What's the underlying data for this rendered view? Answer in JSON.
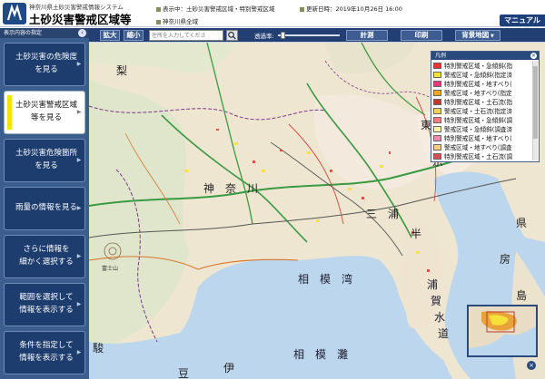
{
  "header": {
    "system_name": "神奈川県土砂災害警戒情報システム",
    "page_title": "土砂災害警戒区域等",
    "display_label": "表示中：土砂災害警戒区域・特別警戒区域",
    "area_label": "神奈川県全域",
    "updated_label": "更新日時：2019年10月26日 16:00",
    "manual_label": "マニュアル"
  },
  "sidebar": {
    "heading": "表示内容の指定",
    "collapse_icon": "chevron-left-icon",
    "items": [
      {
        "label_line1": "土砂災害の危険度",
        "label_line2": "を見る",
        "active": false
      },
      {
        "label_line1": "土砂災害警戒区域",
        "label_line2": "等を見る",
        "active": true
      },
      {
        "label_line1": "土砂災害危険箇所",
        "label_line2": "を見る",
        "active": false
      },
      {
        "label_line1": "雨量の情報を見る",
        "label_line2": "",
        "active": false
      },
      {
        "label_line1": "さらに情報を",
        "label_line2": "細かく選択する",
        "active": false
      },
      {
        "label_line1": "範囲を選択して",
        "label_line2": "情報を表示する",
        "active": false
      },
      {
        "label_line1": "条件を指定して",
        "label_line2": "情報を表示する",
        "active": false
      }
    ]
  },
  "toolbar": {
    "zoom_in": "拡大",
    "zoom_out": "縮小",
    "search_placeholder": "住所を入力してくださ",
    "search_icon": "search-icon",
    "opacity_label": "透過率:",
    "opacity_value": 0.05,
    "measure": "計測",
    "print": "印刷",
    "basemap": "背景地図",
    "basemap_icon": "chevron-down-icon"
  },
  "legend": {
    "heading": "凡例",
    "items": [
      {
        "label": "特別警戒区域・急傾斜(指",
        "color": "#e8372a"
      },
      {
        "label": "警戒区域・急傾斜(指定済",
        "color": "#f5e13a"
      },
      {
        "label": "特別警戒区域・地すべり(",
        "color": "#e23a7a"
      },
      {
        "label": "警戒区域・地すべり(指定",
        "color": "#f4a623"
      },
      {
        "label": "特別警戒区域・土石流(指",
        "color": "#c0392b"
      },
      {
        "label": "警戒区域・土石流(指定済",
        "color": "#f0d25a"
      },
      {
        "label": "特別警戒区域・急傾斜(調",
        "color": "#ff7b7b"
      },
      {
        "label": "警戒区域・急傾斜(調査済",
        "color": "#fff4a0"
      },
      {
        "label": "特別警戒区域・地すべり(",
        "color": "#f08ab0"
      },
      {
        "label": "警戒区域・地すべり(調査",
        "color": "#fbcf7d"
      },
      {
        "label": "特別警戒区域・土石流(調",
        "color": "#d65050"
      }
    ]
  },
  "map": {
    "labels": {
      "kanagawa": "神　奈　川",
      "sagami_wan": "相　模　湾",
      "sagami_nada": "相　模　灘",
      "miura": "三　浦",
      "miura2": "半",
      "uraga": "浦",
      "uraga2": "賀",
      "uraga3": "水",
      "uraga4": "道",
      "tokyo": "京",
      "tokyo2": "東",
      "nashi": "梨",
      "izu": "伊",
      "izu2": "豆",
      "shima": "島",
      "ken": "県",
      "boso": "房",
      "suruga": "駿",
      "fuji": "富士山"
    },
    "overview_label": "overview-map"
  }
}
